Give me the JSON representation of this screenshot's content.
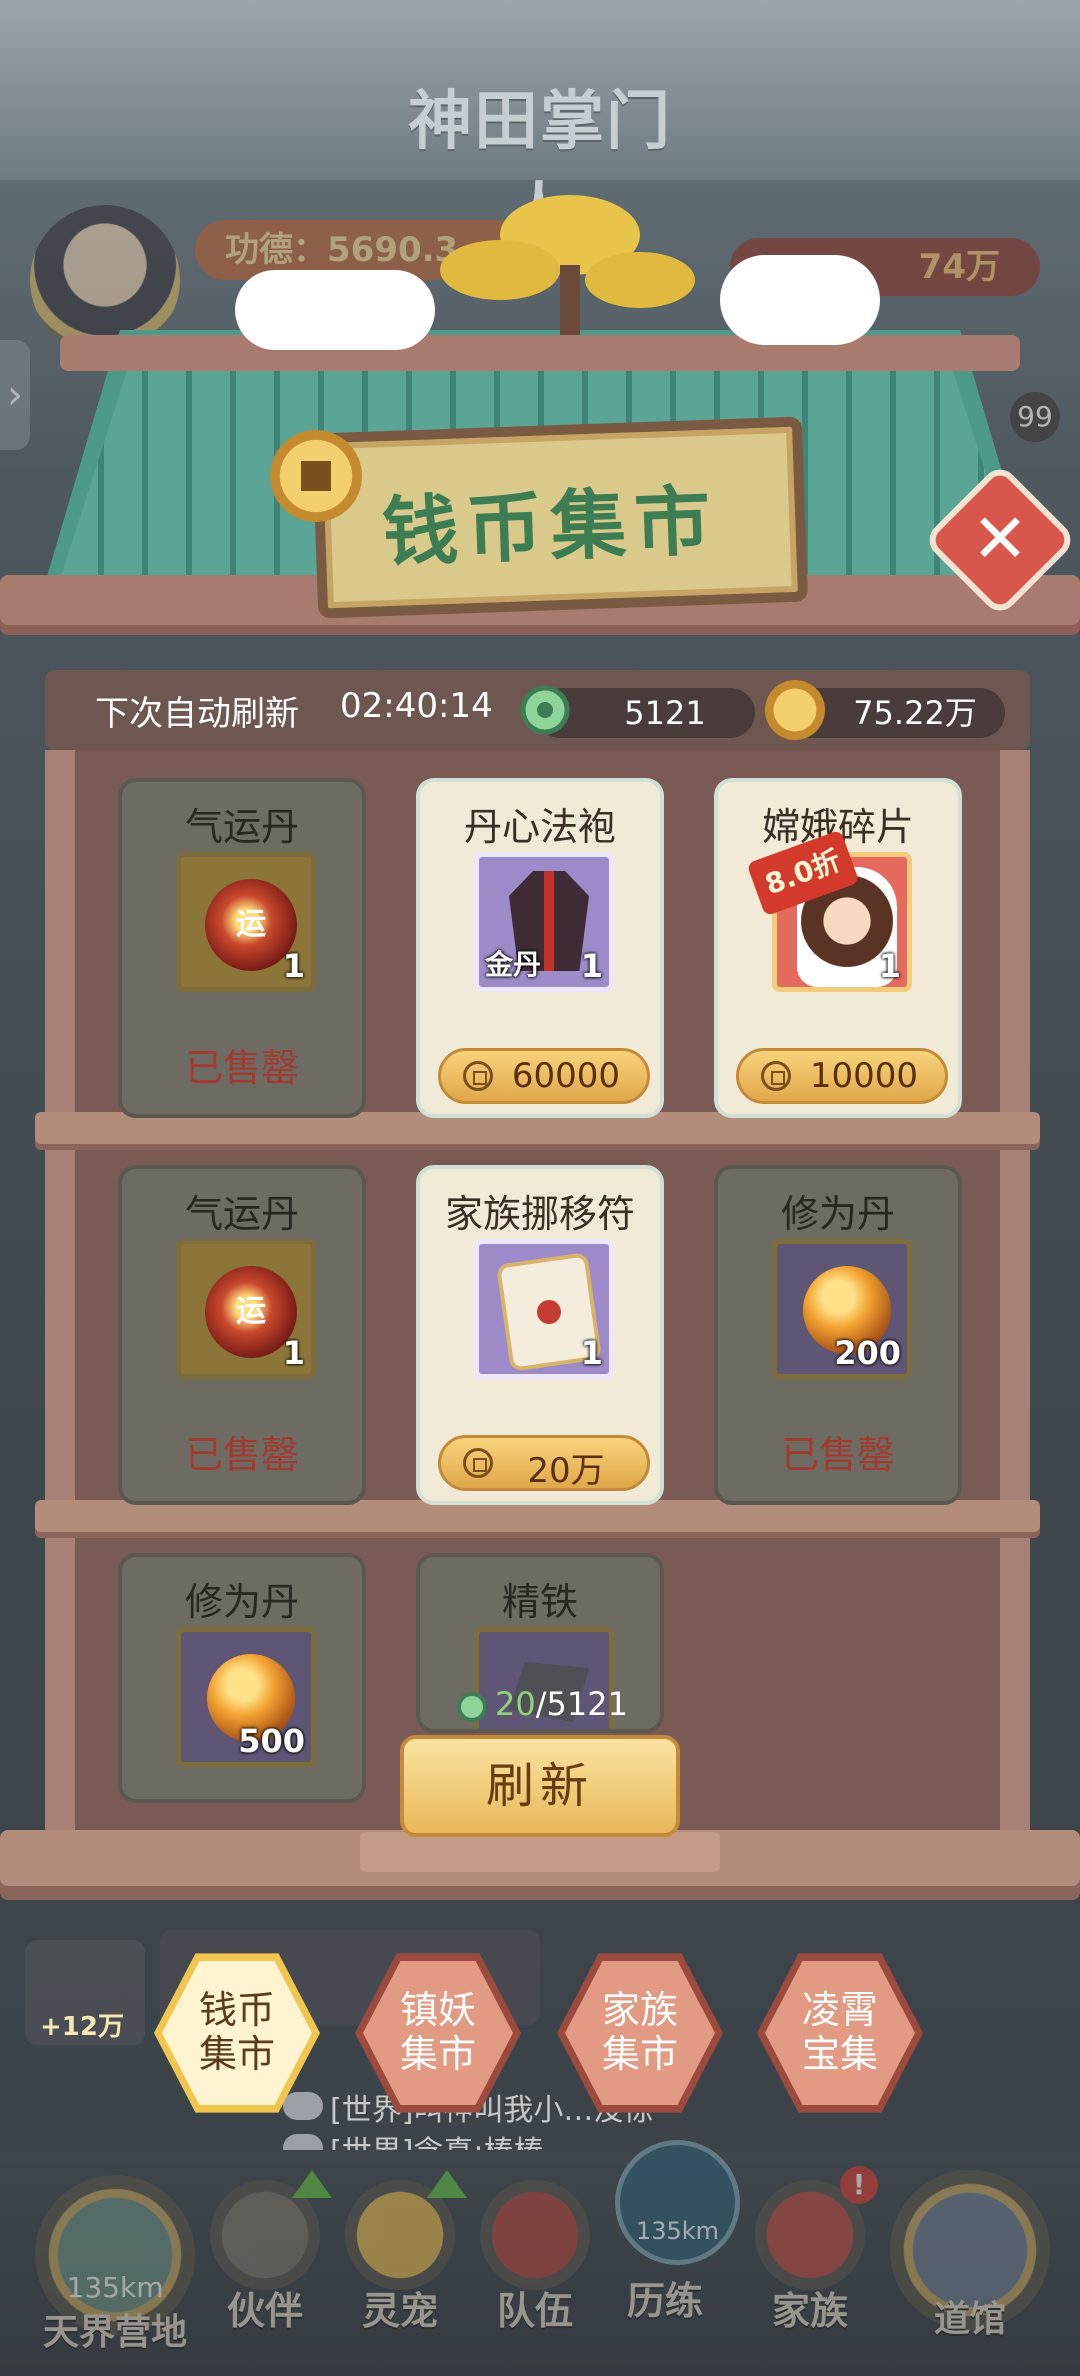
{
  "game": {
    "logo": "神田掌门人"
  },
  "hud": {
    "power_text": "功德：5690.3",
    "coin_text": "74万",
    "coin_small": "75.22万",
    "side_badge": "99"
  },
  "shop": {
    "title": "钱币集市",
    "refresh_label": "下次自动刷新",
    "refresh_timer": "02:40:14",
    "jade_amount": "5121",
    "gold_amount": "75.22万",
    "items": [
      {
        "name": "气运丹",
        "qty": "1",
        "status": "已售罄",
        "icon": "luck-pill-icon",
        "glyph": "运"
      },
      {
        "name": "丹心法袍",
        "qty": "1",
        "tag": "金丹",
        "price": "60000",
        "icon": "robe-icon"
      },
      {
        "name": "嫦娥碎片",
        "qty": "1",
        "discount": "8.0折",
        "price": "10000",
        "icon": "change-fragment-icon"
      },
      {
        "name": "气运丹",
        "qty": "1",
        "status": "已售罄",
        "icon": "luck-pill-icon",
        "glyph": "运"
      },
      {
        "name": "家族挪移符",
        "qty": "1",
        "price": "20万",
        "icon": "scroll-icon"
      },
      {
        "name": "修为丹",
        "qty": "200",
        "status": "已售罄",
        "icon": "cultivation-pill-icon"
      },
      {
        "name": "修为丹",
        "qty": "500",
        "icon": "cultivation-pill-icon"
      },
      {
        "name": "精铁",
        "icon": "iron-icon"
      }
    ],
    "refresh_cost": {
      "spent": "20",
      "total": "/5121"
    },
    "refresh_button": "刷新"
  },
  "tabs": [
    {
      "label_1": "钱币",
      "label_2": "集市",
      "active": true
    },
    {
      "label_1": "镇妖",
      "label_2": "集市",
      "active": false
    },
    {
      "label_1": "家族",
      "label_2": "集市",
      "active": false
    },
    {
      "label_1": "凌霄",
      "label_2": "宝集",
      "active": false
    }
  ],
  "chat": {
    "line1": "[世界]叫神叫我小…没惊",
    "line2": "[世界]念真:棒棒",
    "reward": "+12万"
  },
  "nav": {
    "camp_km": "135km",
    "camp_label": "天界营地",
    "partner": "伙伴",
    "pet": "灵宠",
    "team": "队伍",
    "trial": "历练",
    "trial_km": "135km",
    "clan": "家族",
    "hall": "道馆"
  },
  "colors": {
    "accent_green": "#3d7d53",
    "sold_red": "#a33a30",
    "button_gold": "#e8b85a"
  }
}
